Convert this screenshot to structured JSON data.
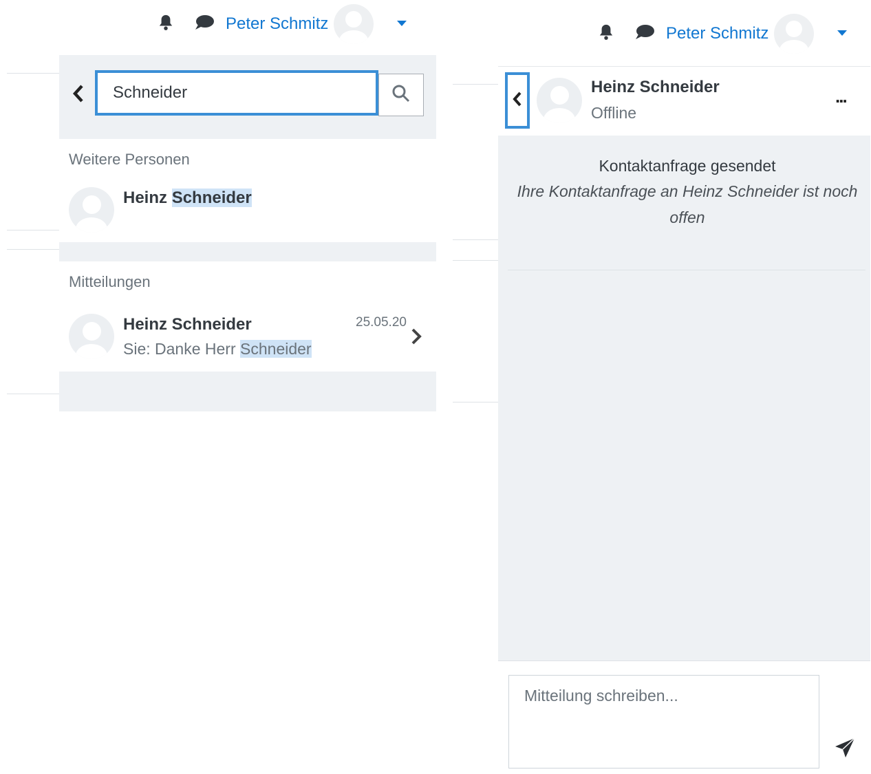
{
  "left": {
    "navbar": {
      "user_name": "Peter Schmitz"
    },
    "search": {
      "value": "Schneider"
    },
    "contacts_section": {
      "title": "Weitere Personen",
      "result": {
        "first": "Heinz",
        "highlight": "Schneider"
      }
    },
    "messages_section": {
      "title": "Mitteilungen",
      "result": {
        "name": "Heinz Schneider",
        "date": "25.05.20",
        "preview_prefix": "Sie: Danke Herr ",
        "preview_highlight": "Schneider"
      }
    }
  },
  "right": {
    "navbar": {
      "user_name": "Peter Schmitz"
    },
    "conversation": {
      "name": "Heinz Schneider",
      "status": "Offline",
      "more_label": "...",
      "notice_title": "Kontaktanfrage gesendet",
      "notice_text": "Ihre Kontaktanfrage an Heinz Schneider ist noch offen"
    },
    "composer": {
      "placeholder": "Mitteilung schreiben..."
    }
  },
  "colors": {
    "accent": "#1177d1",
    "focus": "#3b8fd6",
    "highlight": "#cfe3f6",
    "panel": "#eef1f4"
  },
  "icons": [
    "bell-icon",
    "speech-bubble-icon",
    "caret-down-icon",
    "chevron-left-icon",
    "search-icon",
    "chevron-right-icon",
    "send-icon"
  ]
}
